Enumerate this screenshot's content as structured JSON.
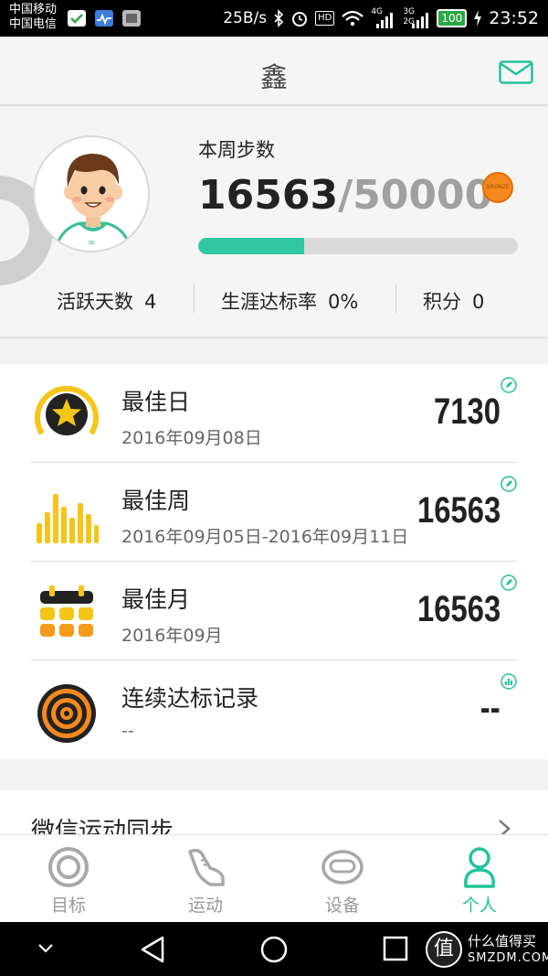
{
  "status_bar": {
    "carrier_1": "中国移动",
    "carrier_2": "中国电信",
    "net_speed": "25B/s",
    "hd_badge": "HD",
    "signal_1": "4G",
    "signal_2": "3G",
    "signal_3": "2G",
    "battery": "100",
    "time": "23:52"
  },
  "header": {
    "title": "鑫",
    "mail_icon": "mail-icon"
  },
  "profile": {
    "week_steps_label": "本周步数",
    "current_steps": "16563",
    "separator": "/",
    "goal_steps": "50000",
    "progress_fraction": 0.3313,
    "medal_text": "BRONZE",
    "stats": [
      {
        "label": "活跃天数",
        "value": "4"
      },
      {
        "label": "生涯达标率",
        "value": "0%"
      },
      {
        "label": "积分",
        "value": "0"
      }
    ]
  },
  "records": [
    {
      "title": "最佳日",
      "date": "2016年09月08日",
      "value": "7130",
      "icon": "star-medal-icon",
      "action_icon": "edit-icon"
    },
    {
      "title": "最佳周",
      "date": "2016年09月05日-2016年09月11日",
      "value": "16563",
      "icon": "bar-chart-icon",
      "action_icon": "edit-icon"
    },
    {
      "title": "最佳月",
      "date": "2016年09月",
      "value": "16563",
      "icon": "calendar-icon",
      "action_icon": "edit-icon"
    },
    {
      "title": "连续达标记录",
      "date": "--",
      "value": "--",
      "icon": "target-icon",
      "action_icon": "chart-icon"
    }
  ],
  "sync": {
    "label": "微信运动同步"
  },
  "nav": [
    {
      "label": "目标",
      "icon": "target-nav-icon",
      "active": false
    },
    {
      "label": "运动",
      "icon": "shoe-icon",
      "active": false
    },
    {
      "label": "设备",
      "icon": "band-icon",
      "active": false
    },
    {
      "label": "个人",
      "icon": "person-icon",
      "active": true
    }
  ],
  "watermark": {
    "badge": "值",
    "line1": "什么值得买",
    "line2": "SMZDM.COM"
  },
  "colors": {
    "accent": "#22c39c",
    "progress": "#31c7a1",
    "medal": "#f5891f",
    "gold": "#f5c518"
  }
}
